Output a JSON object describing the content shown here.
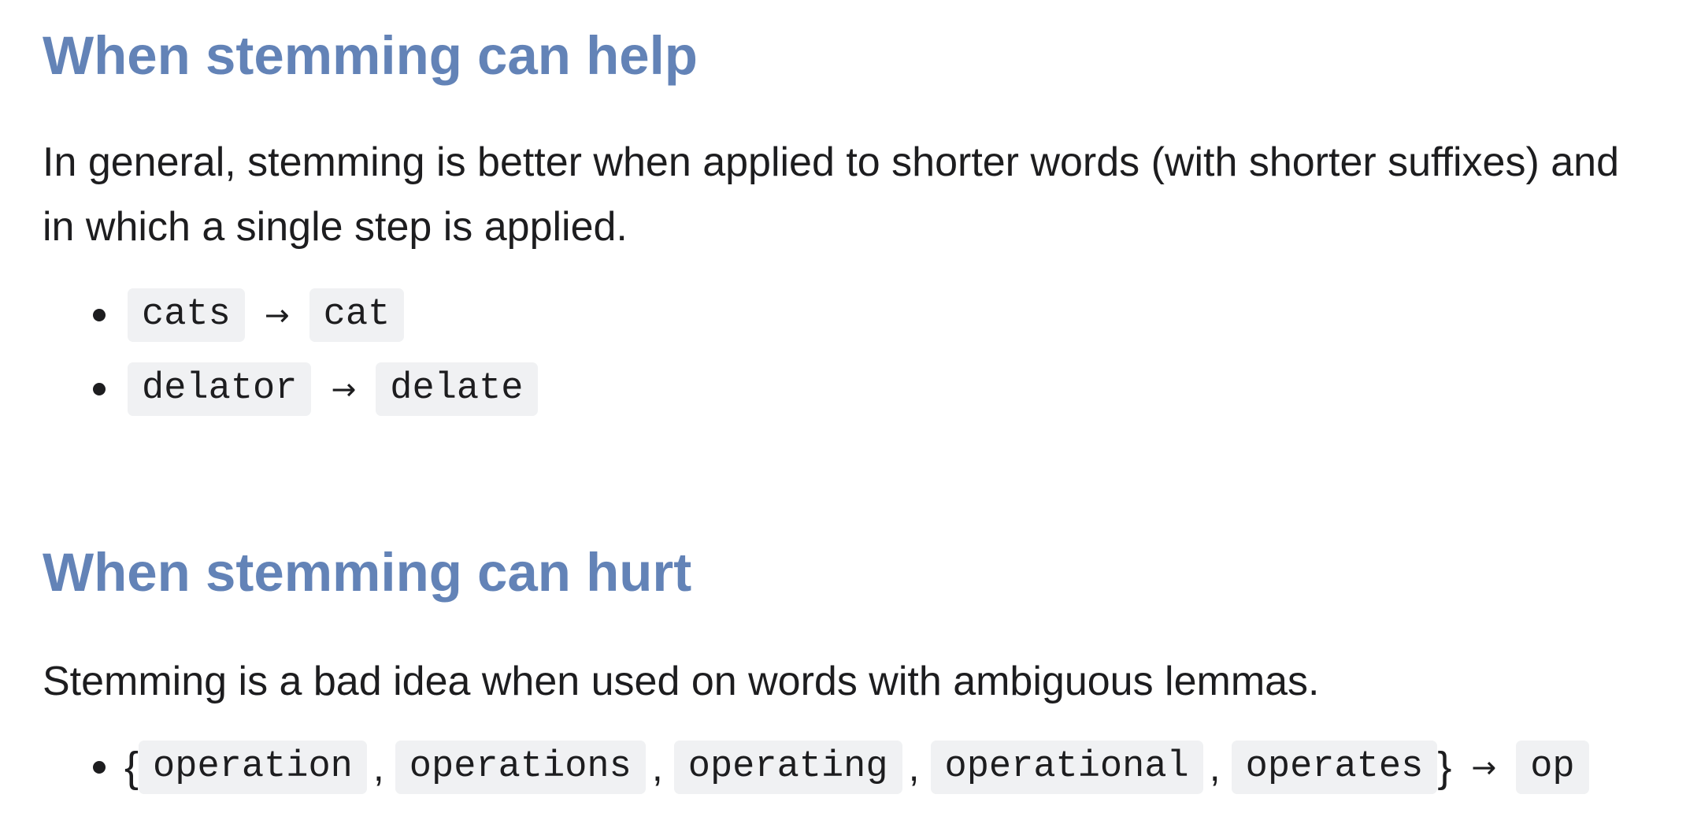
{
  "section_help": {
    "heading": "When stemming can help",
    "paragraph": "In general, stemming is better when applied to shorter words (with shorter suffixes) and",
    "paragraph_line2": "in which a single step is applied.",
    "examples": [
      {
        "from": "cats",
        "arrow": "→",
        "to": "cat"
      },
      {
        "from": "delator",
        "arrow": "→",
        "to": "delate"
      }
    ]
  },
  "section_hurt": {
    "heading": "When stemming can hurt",
    "paragraph": "Stemming is a bad idea when used on words with ambiguous lemmas.",
    "example": {
      "open_brace": "{",
      "close_brace": "}",
      "separator": ",",
      "words": [
        "operation",
        "operations",
        "operating",
        "operational",
        "operates"
      ],
      "arrow": "→",
      "to": "op"
    }
  }
}
